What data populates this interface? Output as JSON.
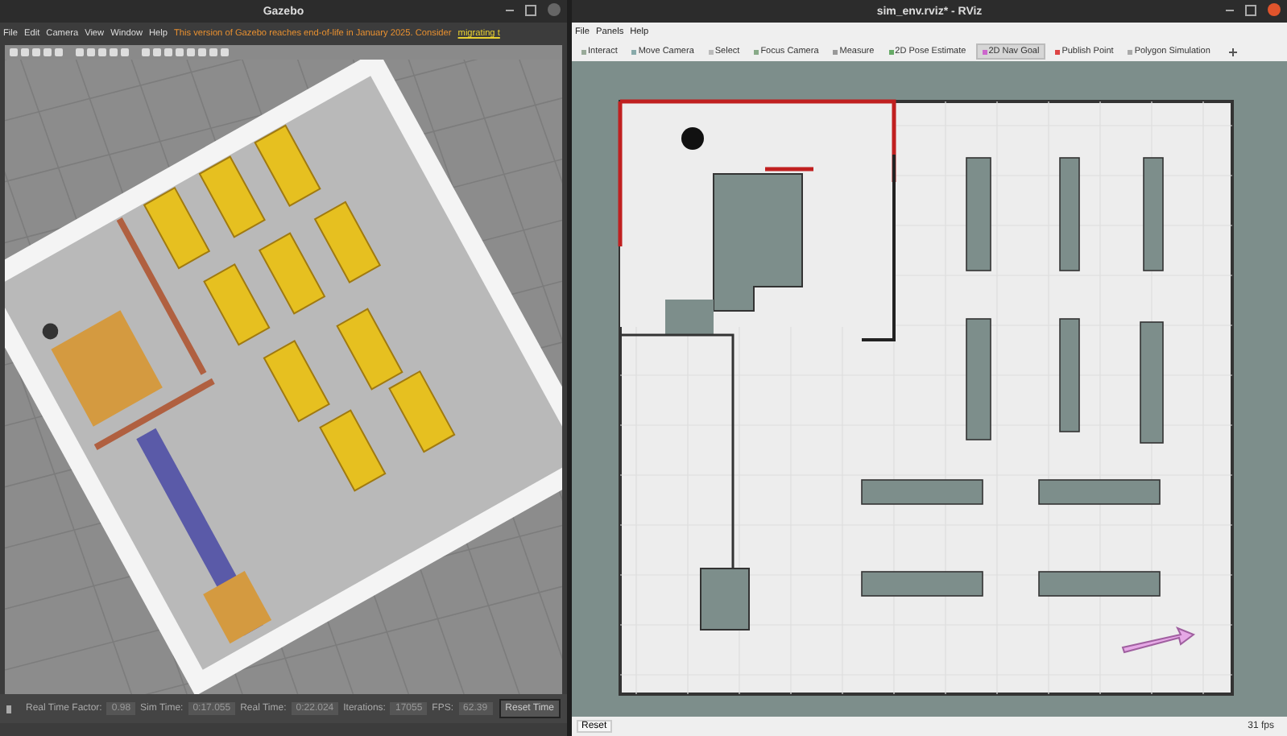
{
  "gazebo": {
    "window": {
      "title": "Gazebo"
    },
    "menu": [
      "File",
      "Edit",
      "Camera",
      "View",
      "Window",
      "Help"
    ],
    "notice": {
      "text": "This version of Gazebo reaches end-of-life in January 2025. Consider",
      "link": "migrating t"
    },
    "stats": [
      {
        "label": "Real Time Factor:",
        "value": "0.98"
      },
      {
        "label": "Sim Time:",
        "value": "0:17.055"
      },
      {
        "label": "Real Time:",
        "value": "0:22.024"
      },
      {
        "label": "Iterations:",
        "value": "17055"
      },
      {
        "label": "FPS:",
        "value": "62.39"
      }
    ],
    "reset_button": "Reset Time"
  },
  "rviz": {
    "window": {
      "title": "sim_env.rviz* - RViz"
    },
    "menu": [
      "File",
      "Panels",
      "Help"
    ],
    "tools": [
      {
        "label": "Interact",
        "selected": false
      },
      {
        "label": "Move Camera",
        "selected": false
      },
      {
        "label": "Select",
        "selected": false
      },
      {
        "label": "Focus Camera",
        "selected": false
      },
      {
        "label": "Measure",
        "selected": false
      },
      {
        "label": "2D Pose Estimate",
        "selected": false
      },
      {
        "label": "2D Nav Goal",
        "selected": true
      },
      {
        "label": "Publish Point",
        "selected": false
      },
      {
        "label": "Polygon Simulation",
        "selected": false
      }
    ],
    "reset_button": "Reset",
    "fps": "31 fps"
  }
}
